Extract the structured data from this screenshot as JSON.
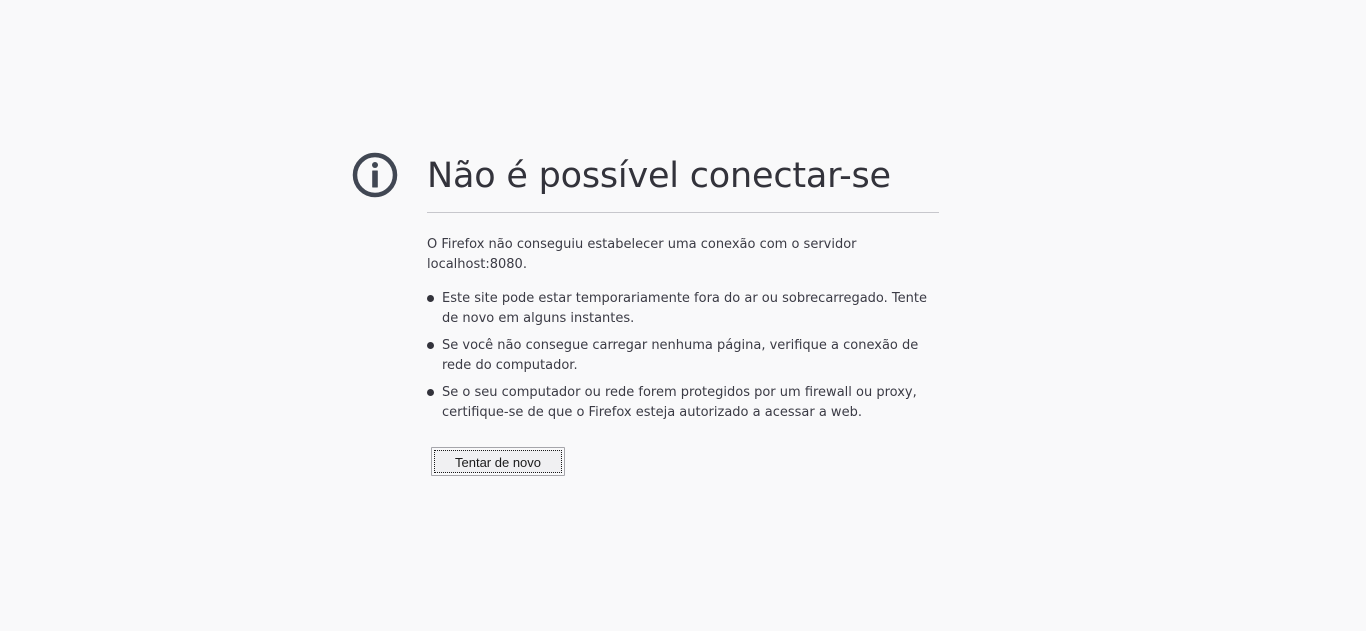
{
  "page": {
    "icon": "info-icon",
    "title": "Não é possível conectar-se",
    "description": "O Firefox não conseguiu estabelecer uma conexão com o servidor localhost:8080.",
    "suggestions": [
      "Este site pode estar temporariamente fora do ar ou sobrecarregado. Tente de novo em alguns instantes.",
      "Se você não consegue carregar nenhuma página, verifique a conexão de rede do computador.",
      "Se o seu computador ou rede forem protegidos por um firewall ou proxy, certifique-se de que o Firefox esteja autorizado a acessar a web."
    ],
    "retry_label": "Tentar de novo"
  },
  "colors": {
    "background": "#f9f9fa",
    "text": "#3b3b45",
    "icon": "#414753"
  }
}
